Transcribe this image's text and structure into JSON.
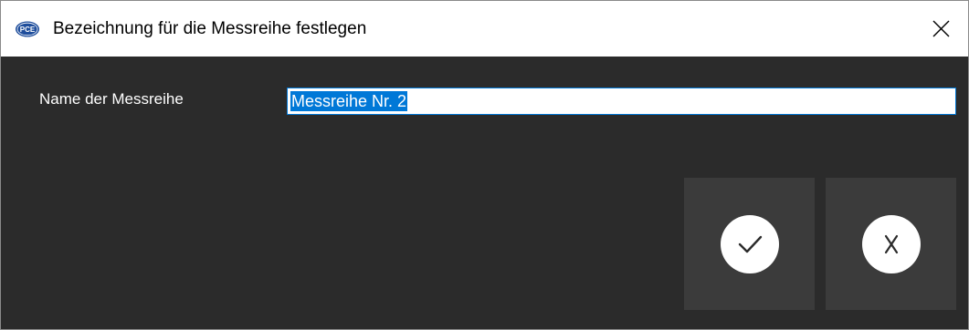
{
  "window": {
    "title": "Bezeichnung für die Messreihe festlegen",
    "logo_icon": "pce-logo-icon",
    "close_icon": "close-icon"
  },
  "form": {
    "name_label": "Name der Messreihe",
    "name_value": "Messreihe Nr. 2"
  },
  "buttons": {
    "confirm_icon": "checkmark-icon",
    "cancel_icon": "x-icon"
  },
  "colors": {
    "background": "#2b2b2b",
    "button_bg": "#3b3b3b",
    "selection": "#0078d7"
  }
}
